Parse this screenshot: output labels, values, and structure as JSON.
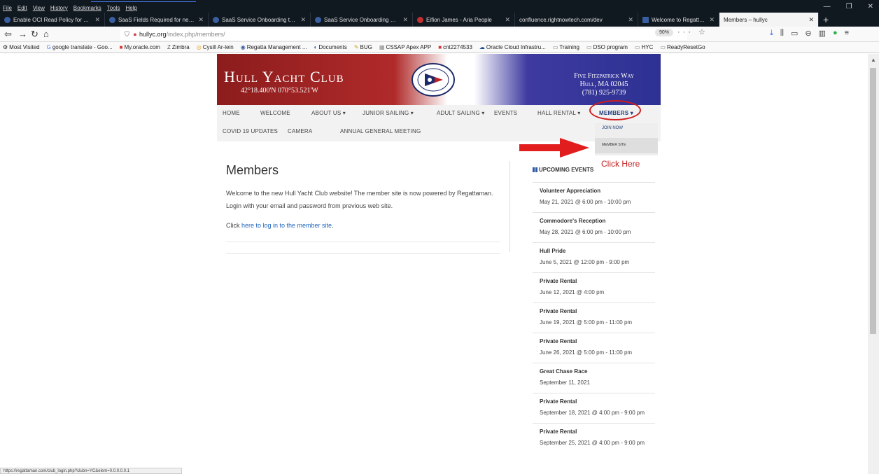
{
  "menu": [
    "File",
    "Edit",
    "View",
    "History",
    "Bookmarks",
    "Tools",
    "Help"
  ],
  "window_controls": [
    "—",
    "❐",
    "✕"
  ],
  "tabs": [
    {
      "label": "Enable OCI Read Policy for Sys",
      "active": false
    },
    {
      "label": "SaaS Fields Required for new s",
      "active": false
    },
    {
      "label": "SaaS Service Onboarding toolk",
      "active": false
    },
    {
      "label": "SaaS Service Onboarding Overv",
      "active": false
    },
    {
      "label": "Eifion James - Aria People",
      "active": false
    },
    {
      "label": "confluence.rightnowtech.com/dev",
      "active": false
    },
    {
      "label": "Welcome to Regatta Managem",
      "active": false
    },
    {
      "label": "Members – hullyc",
      "active": true
    }
  ],
  "address": {
    "domain": "hullyc.org",
    "path": "/index.php/members/",
    "zoom": "90%"
  },
  "bookmarks": [
    {
      "label": "Most Visited",
      "icon": "gear-icon"
    },
    {
      "label": "google translate - Goo...",
      "icon": "google-icon"
    },
    {
      "label": "My.oracle.com",
      "icon": "oracle-icon"
    },
    {
      "label": "Zimbra",
      "icon": "zimbra-icon"
    },
    {
      "label": "Cysill Ar-lein",
      "icon": "globe-icon"
    },
    {
      "label": "Regatta Management ...",
      "icon": "globe-icon"
    },
    {
      "label": "Documents",
      "icon": "docs-icon"
    },
    {
      "label": "BUG",
      "icon": "bug-icon"
    },
    {
      "label": "CSSAP Apex APP",
      "icon": "app-icon"
    },
    {
      "label": "cnt2274533",
      "icon": "oracle-icon"
    },
    {
      "label": "Oracle Cloud Infrastru...",
      "icon": "cloud-icon"
    },
    {
      "label": "Training",
      "icon": "folder-icon"
    },
    {
      "label": "DSO program",
      "icon": "folder-icon"
    },
    {
      "label": "HYC",
      "icon": "folder-icon"
    },
    {
      "label": "ReadyResetGo",
      "icon": "folder-icon"
    }
  ],
  "site": {
    "club_name": "Hull Yacht Club",
    "coords": "42°18.400'N 070°53.521'W",
    "address_lines": [
      "Five Fitzpatrick Way",
      "Hull, MA 02045",
      "(781) 925-9739"
    ],
    "colors": {
      "banner_left": "#8c1c1c",
      "banner_right": "#2d3192",
      "accent": "#23407a",
      "annotation_red": "#d01e1e"
    }
  },
  "nav": {
    "home": "HOME",
    "welcome": "WELCOME",
    "about": "ABOUT US ▾",
    "junior": "JUNIOR SAILING ▾",
    "adult": "ADULT SAILING ▾",
    "events": "EVENTS",
    "hall": "HALL RENTAL ▾",
    "members": "MEMBERS ▾",
    "covid": "COVID 19 UPDATES",
    "camera": "CAMERA",
    "agm": "ANNUAL GENERAL MEETING"
  },
  "dropdown": {
    "join": "JOIN NOW",
    "member_site": "MEMBER SITE"
  },
  "annotation": {
    "click_here": "Click Here"
  },
  "page": {
    "title": "Members",
    "para1": "Welcome to the new Hull Yacht Club website! The member site is now powered by Regattaman. Login with your email and password from previous web site.",
    "para2_prefix": "Click ",
    "para2_link": "here to log in to the member site",
    "para2_suffix": "."
  },
  "events_heading": "UPCOMING EVENTS",
  "events": [
    {
      "title": "Volunteer Appreciation",
      "date": "May 21, 2021 @ 6:00 pm - 10:00 pm"
    },
    {
      "title": "Commodore's Reception",
      "date": "May 28, 2021 @ 6:00 pm - 10:00 pm"
    },
    {
      "title": "Hull Pride",
      "date": "June 5, 2021 @ 12:00 pm - 9:00 pm"
    },
    {
      "title": "Private Rental",
      "date": "June 12, 2021 @ 4:00 pm"
    },
    {
      "title": "Private Rental",
      "date": "June 19, 2021 @ 5:00 pm - 11:00 pm"
    },
    {
      "title": "Private Rental",
      "date": "June 26, 2021 @ 5:00 pm - 11:00 pm"
    },
    {
      "title": "Great Chase Race",
      "date": "September 11, 2021"
    },
    {
      "title": "Private Rental",
      "date": "September 18, 2021 @ 4:00 pm - 9:00 pm"
    },
    {
      "title": "Private Rental",
      "date": "September 25, 2021 @ 4:00 pm - 9:00 pm"
    }
  ],
  "status_url": "https://regattaman.com/club_login.php?clubn=YC&elem=0.0.0.0.0.1"
}
